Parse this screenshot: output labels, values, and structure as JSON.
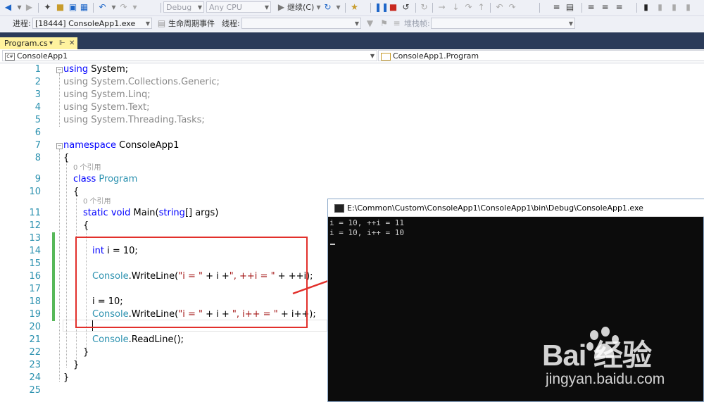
{
  "toolbar": {
    "config_combo": "Debug",
    "platform_combo": "Any CPU",
    "continue_label": "继续(C)",
    "icons": [
      "back-icon",
      "forward-icon",
      "new-project-icon",
      "open-icon",
      "save-icon",
      "save-all-icon",
      "undo-icon",
      "redo-icon",
      "start-debug-icon",
      "refresh-icon",
      "pause-icon",
      "stop-icon",
      "restart-icon",
      "show-next-statement-icon",
      "step-into-icon",
      "step-over-icon",
      "step-out-icon",
      "bookmark-icon"
    ]
  },
  "debug_bar": {
    "process_label": "进程:",
    "process_value": "[18444] ConsoleApp1.exe",
    "lifecycle_label": "生命周期事件",
    "thread_label": "线程:",
    "stackframe_label": "堆栈帧:"
  },
  "tabs": [
    {
      "label": "Program.cs",
      "active": true
    }
  ],
  "navbar": {
    "project": "ConsoleApp1",
    "class": "ConsoleApp1.Program"
  },
  "editor": {
    "line_numbers": [
      "1",
      "2",
      "3",
      "4",
      "5",
      "6",
      "7",
      "8",
      "9",
      "10",
      "11",
      "12",
      "13",
      "14",
      "15",
      "16",
      "17",
      "18",
      "19",
      "20",
      "21",
      "22",
      "23",
      "24",
      "25"
    ],
    "lines": {
      "l1_kw": "using",
      "l1_rest": " System;",
      "l2": "using System.Collections.Generic;",
      "l3": "using System.Linq;",
      "l4": "using System.Text;",
      "l5": "using System.Threading.Tasks;",
      "l7_kw": "namespace",
      "l7_rest": " ConsoleApp1",
      "l8": "{",
      "ref1": "0 个引用",
      "l9_kw": "class",
      "l9_type": " Program",
      "l10": "{",
      "ref2": "0 个引用",
      "l11_kw1": "static",
      "l11_kw2": " void",
      "l11_mid": " Main(",
      "l11_kw3": "string",
      "l11_end": "[] args)",
      "l12": "{",
      "l14_kw": "int",
      "l14_rest": " i = 10;",
      "l16_type": "Console",
      "l16_a": ".WriteLine(",
      "l16_s1": "\"i = \"",
      "l16_b": " + i +",
      "l16_s2": "\", ++i = \"",
      "l16_c": " + ++i);",
      "l18": "i = 10;",
      "l19_type": "Console",
      "l19_a": ".WriteLine(",
      "l19_s1": "\"i = \"",
      "l19_b": " + i + ",
      "l19_s2": "\", i++ = \"",
      "l19_c": " + i++);",
      "l21_type": "Console",
      "l21_rest": ".ReadLine();",
      "l22": "}",
      "l23": "}",
      "l24": "}"
    }
  },
  "console": {
    "title": "E:\\Common\\Custom\\ConsoleApp1\\ConsoleApp1\\bin\\Debug\\ConsoleApp1.exe",
    "output": [
      "i = 10, ++i = 11",
      "i = 10, i++ = 10"
    ]
  },
  "colors": {
    "keyword": "#0000ff",
    "type": "#2b91af",
    "string": "#a31515",
    "line_number": "#2b91af",
    "highlight_box": "#e2302b",
    "tab_active": "#fff29e",
    "tab_row": "#2b3b59"
  },
  "watermark": {
    "logo": "Bai  经验",
    "url": "jingyan.baidu.com"
  }
}
